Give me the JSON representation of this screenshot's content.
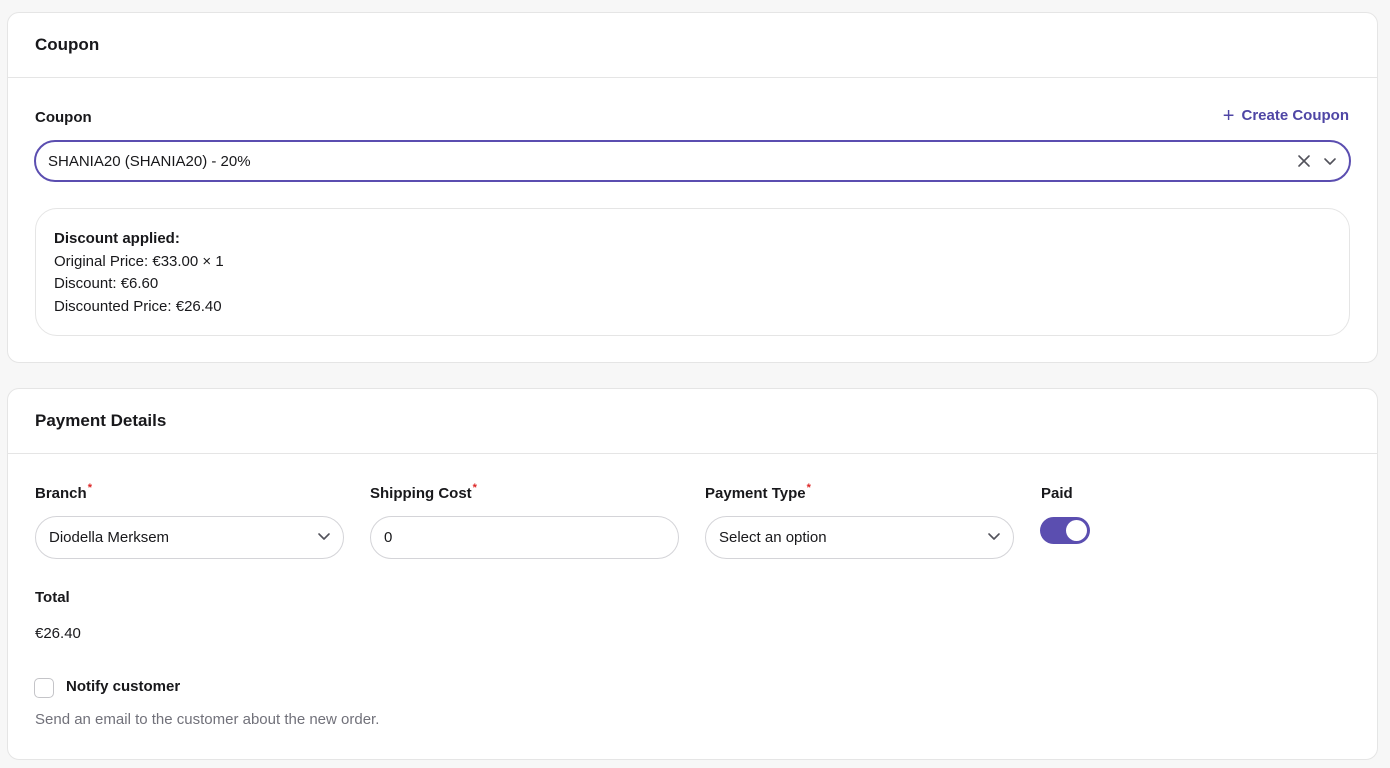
{
  "coupon_section": {
    "header": "Coupon",
    "field_label": "Coupon",
    "create_label": "Create Coupon",
    "selected_value": "SHANIA20 (SHANIA20) - 20%",
    "discount": {
      "title": "Discount applied:",
      "original_price": "Original Price: €33.00 × 1",
      "discount": "Discount: €6.60",
      "discounted_price": "Discounted Price: €26.40"
    }
  },
  "payment_section": {
    "header": "Payment Details",
    "branch": {
      "label": "Branch",
      "value": "Diodella Merksem"
    },
    "shipping_cost": {
      "label": "Shipping Cost",
      "value": "0"
    },
    "payment_type": {
      "label": "Payment Type",
      "value": "Select an option"
    },
    "paid": {
      "label": "Paid",
      "checked": true
    },
    "total": {
      "label": "Total",
      "value": "€26.40"
    },
    "notify": {
      "label": "Notify customer",
      "checked": false,
      "hint": "Send an email to the customer about the new order."
    },
    "required_mark": "*"
  },
  "colors": {
    "accent": "#5b4eb0",
    "link": "#4f46a5",
    "required": "#dc2626"
  }
}
